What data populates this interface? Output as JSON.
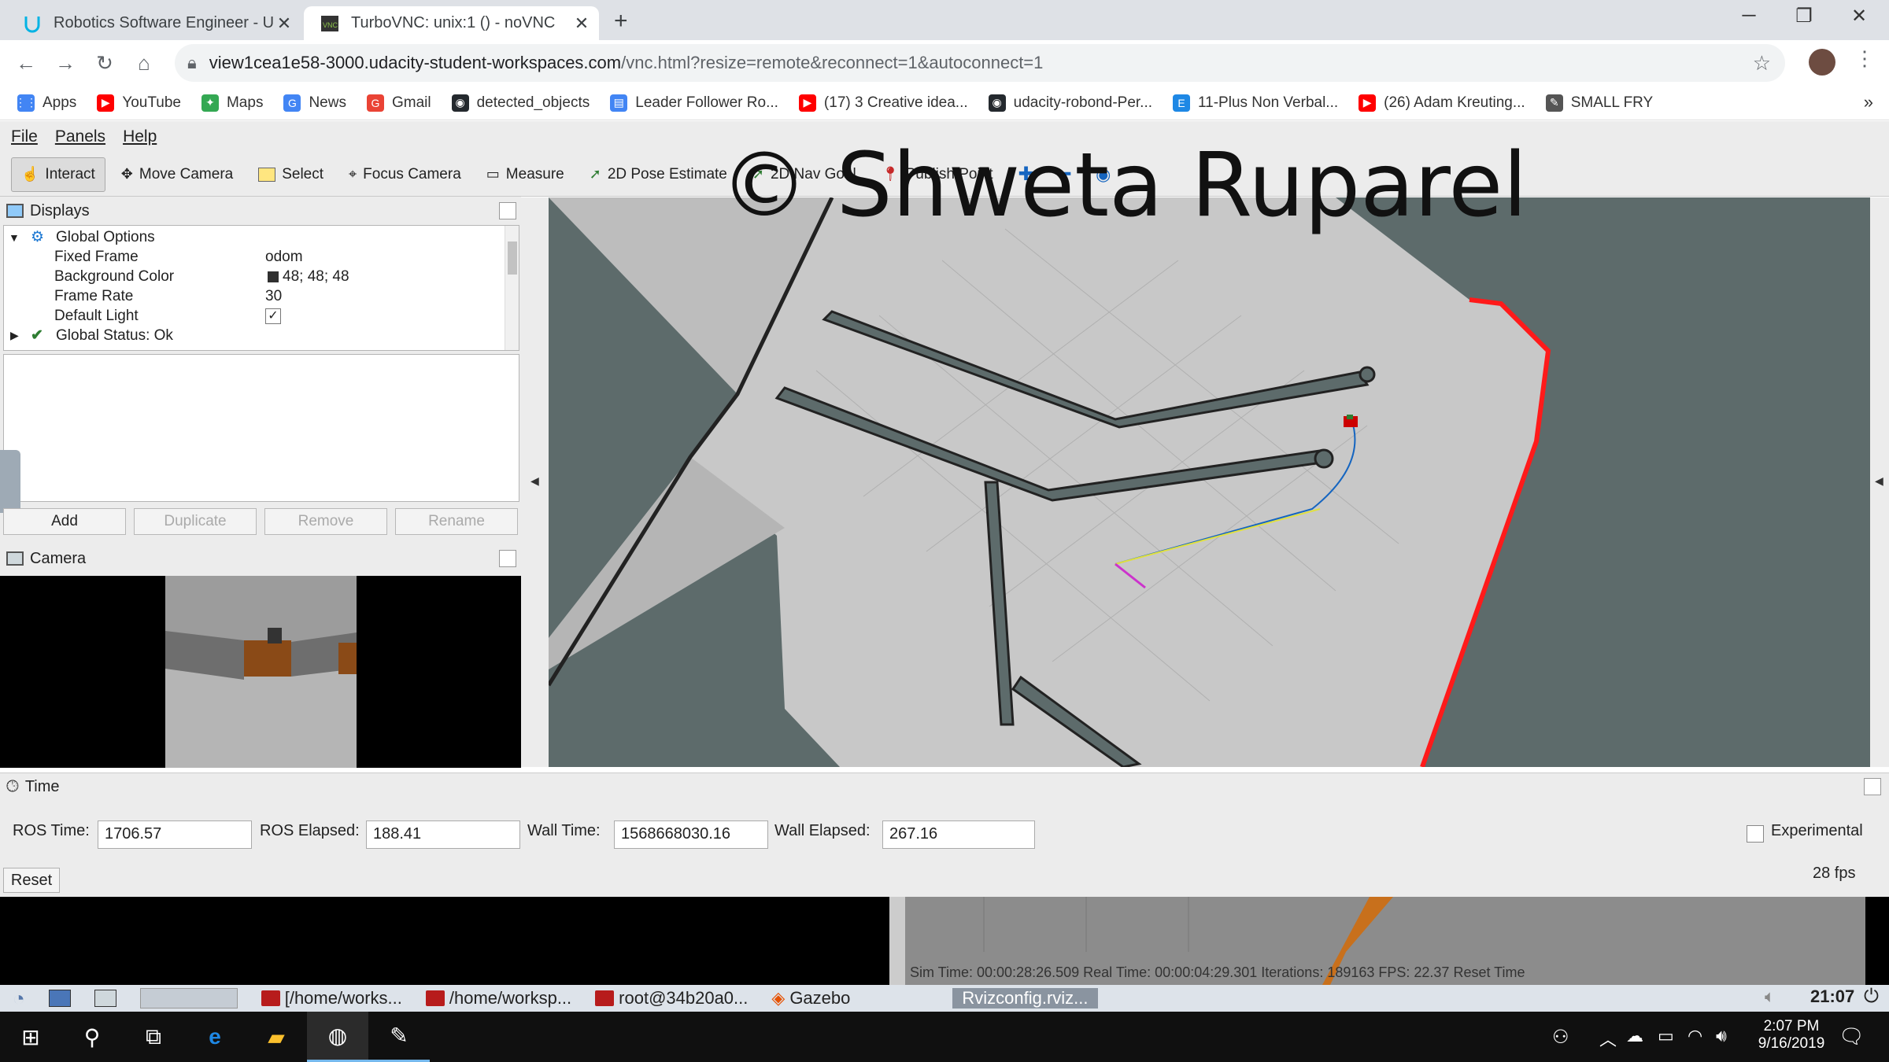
{
  "browser": {
    "tabs": [
      {
        "title": "Robotics Software Engineer - Ud",
        "icon": "udacity-icon"
      },
      {
        "title": "TurboVNC: unix:1 () - noVNC",
        "icon": "vnc-icon"
      }
    ],
    "url_host": "view1cea1e58-3000.udacity-student-workspaces.com",
    "url_path": "/vnc.html?resize=remote&reconnect=1&autoconnect=1",
    "bookmarks": [
      {
        "label": "Apps",
        "icon": "apps-grid-icon",
        "color": "#4285f4"
      },
      {
        "label": "YouTube",
        "icon": "youtube-icon",
        "color": "#ff0000"
      },
      {
        "label": "Maps",
        "icon": "maps-icon",
        "color": "#34a853"
      },
      {
        "label": "News",
        "icon": "news-icon",
        "color": "#4285f4"
      },
      {
        "label": "Gmail",
        "icon": "google-icon",
        "color": "#ea4335"
      },
      {
        "label": "detected_objects",
        "icon": "github-icon",
        "color": "#24292e"
      },
      {
        "label": "Leader Follower Ro...",
        "icon": "doc-icon",
        "color": "#4285f4"
      },
      {
        "label": "(17) 3 Creative idea...",
        "icon": "youtube-icon",
        "color": "#ff0000"
      },
      {
        "label": "udacity-robond-Per...",
        "icon": "github-icon",
        "color": "#24292e"
      },
      {
        "label": "11-Plus Non Verbal...",
        "icon": "ef-icon",
        "color": "#1e88e5"
      },
      {
        "label": "(26) Adam Kreuting...",
        "icon": "youtube-icon",
        "color": "#ff0000"
      },
      {
        "label": "SMALL FRY",
        "icon": "feather-icon",
        "color": "#555555"
      }
    ]
  },
  "rviz": {
    "menu": [
      "File",
      "Panels",
      "Help"
    ],
    "tools": [
      "Interact",
      "Move Camera",
      "Select",
      "Focus Camera",
      "Measure",
      "2D Pose Estimate",
      "2D Nav Goal",
      "Publish Point"
    ],
    "displays_title": "Displays",
    "tree": [
      {
        "label": "Global Options",
        "value": ""
      },
      {
        "label": "Fixed Frame",
        "value": "odom"
      },
      {
        "label": "Background Color",
        "value": "48; 48; 48"
      },
      {
        "label": "Frame Rate",
        "value": "30"
      },
      {
        "label": "Default Light",
        "value": "✓"
      },
      {
        "label": "Global Status: Ok",
        "value": ""
      }
    ],
    "buttons": [
      "Add",
      "Duplicate",
      "Remove",
      "Rename"
    ],
    "camera_title": "Camera",
    "time_title": "Time",
    "time": {
      "ros_time_label": "ROS Time:",
      "ros_time": "1706.57",
      "ros_elapsed_label": "ROS Elapsed:",
      "ros_elapsed": "188.41",
      "wall_time_label": "Wall Time:",
      "wall_time": "1568668030.16",
      "wall_elapsed_label": "Wall Elapsed:",
      "wall_elapsed": "267.16",
      "experimental": "Experimental",
      "reset": "Reset",
      "fps": "28 fps"
    },
    "watermark": "© Shweta Ruparel"
  },
  "gazebo_strip": "Sim Time: 00:00:28:26.509   Real Time: 00:00:04:29.301   Iterations: 189163   FPS: 22.37   Reset Time",
  "x_taskbar": {
    "items": [
      "[/home/works...",
      "/home/worksp...",
      "root@34b20a0...",
      "Gazebo",
      "Rvizconfig.rviz..."
    ],
    "clock": "21:07"
  },
  "windows_taskbar": {
    "time": "2:07 PM",
    "date": "9/16/2019"
  },
  "colors": {
    "background": "#303030",
    "wall": "#ff1a1a",
    "path": "#e0e040"
  }
}
